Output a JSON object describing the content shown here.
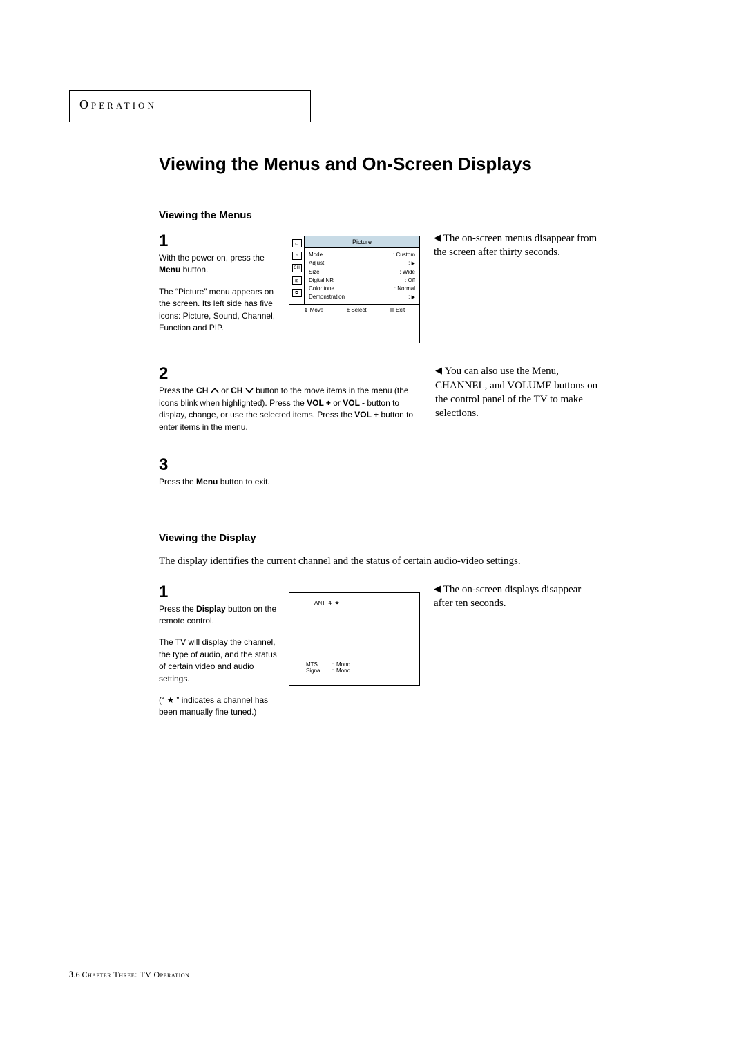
{
  "chapter_label": "Operation",
  "page_title": "Viewing the Menus and On-Screen Displays",
  "section1": {
    "title": "Viewing the Menus",
    "note1": " The on-screen menus disappear from the screen after thirty seconds.",
    "note2": " You can also use the Menu, CHANNEL, and VOLUME buttons on the control panel of the TV to make selections.",
    "step1": {
      "num": "1",
      "p1a": "With the power on, press the ",
      "p1b": "Menu",
      "p1c": " button.",
      "p2": "The “Picture” menu appears on the screen. Its left side has five icons: Picture, Sound, Channel, Function and PIP."
    },
    "step2": {
      "num": "2",
      "p_a": "Press the ",
      "p_b": "CH",
      "p_c": " or ",
      "p_d": "CH",
      "p_e": " button to the move items in the menu (the icons blink when highlighted). Press the ",
      "p_f": "VOL +",
      "p_g": " or ",
      "p_h": "VOL -",
      "p_i": " button to display, change, or use the selected items. Press the ",
      "p_j": "VOL +",
      "p_k": " button to enter items in the menu."
    },
    "step3": {
      "num": "3",
      "p_a": "Press the ",
      "p_b": "Menu",
      "p_c": " button to exit."
    }
  },
  "osd_menu": {
    "header": "Picture",
    "rows": [
      {
        "k": "Mode",
        "v": "Custom"
      },
      {
        "k": "Adjust",
        "v": "arrow"
      },
      {
        "k": "Size",
        "v": "Wide"
      },
      {
        "k": "Digital NR",
        "v": "Off"
      },
      {
        "k": "Color tone",
        "v": "Normal"
      },
      {
        "k": "Demonstration",
        "v": "arrow"
      }
    ],
    "footer": {
      "move": "Move",
      "select": "± Select",
      "exit": "Exit"
    },
    "icons": [
      "▭",
      "♫",
      "CH",
      "⊞",
      "⧉"
    ]
  },
  "section2": {
    "title": "Viewing the Display",
    "intro": "The display identifies the current channel and the status of certain audio-video settings.",
    "note": " The on-screen displays disappear after ten seconds.",
    "step1": {
      "num": "1",
      "p1a": "Press the ",
      "p1b": "Display",
      "p1c": " button on the remote control.",
      "p2": "The TV will display the channel, the type of audio, and the status of certain video and audio settings.",
      "p3": "(“ ★ ” indicates a channel has been manually fine tuned.)"
    }
  },
  "osd_display": {
    "ant": "ANT  4  ★",
    "rows": [
      {
        "k": "MTS",
        "v": "Mono"
      },
      {
        "k": "Signal",
        "v": "Mono"
      }
    ]
  },
  "footer": {
    "pagenum_bold": "3",
    "pagenum_rest": ".6",
    "text": " Chapter Three: TV Operation"
  }
}
